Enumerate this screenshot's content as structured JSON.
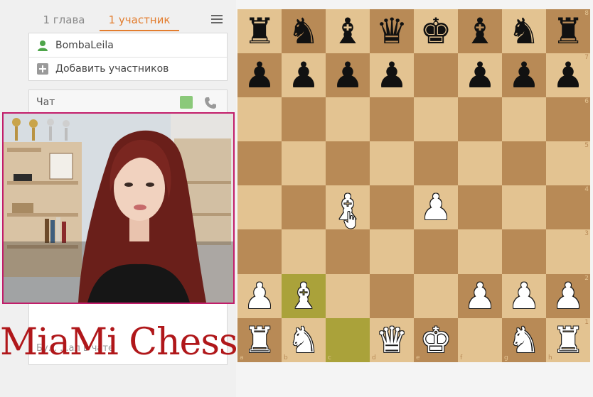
{
  "tabs": {
    "chapters": "1 глава",
    "participants": "1 участник"
  },
  "participants": {
    "user_name": "BombaLeila",
    "add_label": "Добавить участников"
  },
  "chat": {
    "title": "Чат",
    "input_placeholder": "Бу... ...ал в чате"
  },
  "watermark": "MiaMi Chess",
  "board": {
    "rank_labels": [
      "8",
      "7",
      "6",
      "5",
      "4",
      "3",
      "2",
      "1"
    ],
    "file_labels": [
      "a",
      "b",
      "c",
      "d",
      "e",
      "f",
      "g",
      "h"
    ],
    "position": [
      [
        "bR",
        "bN",
        "bB",
        "bQ",
        "bK",
        "bB",
        "bN",
        "bR"
      ],
      [
        "bP",
        "bP",
        "bP",
        "bP",
        "",
        "bP",
        "bP",
        "bP"
      ],
      [
        "",
        "",
        "",
        "",
        "",
        "",
        "",
        ""
      ],
      [
        "",
        "",
        "",
        "",
        "",
        "",
        "",
        ""
      ],
      [
        "",
        "",
        "wB",
        "",
        "wP",
        "",
        "",
        ""
      ],
      [
        "",
        "",
        "",
        "",
        "",
        "",
        "",
        ""
      ],
      [
        "wP",
        "wB",
        "",
        "",
        "",
        "wP",
        "wP",
        "wP"
      ],
      [
        "wR",
        "wN",
        "",
        "wQ",
        "wK",
        "",
        "wN",
        "wR"
      ]
    ],
    "highlighted_squares": [
      "b2",
      "c1"
    ]
  },
  "colors": {
    "accent": "#e37d2e",
    "board_light": "#e3c391",
    "board_dark": "#b88a56",
    "webcam_border": "#c21d6a",
    "watermark": "#b0171a"
  }
}
